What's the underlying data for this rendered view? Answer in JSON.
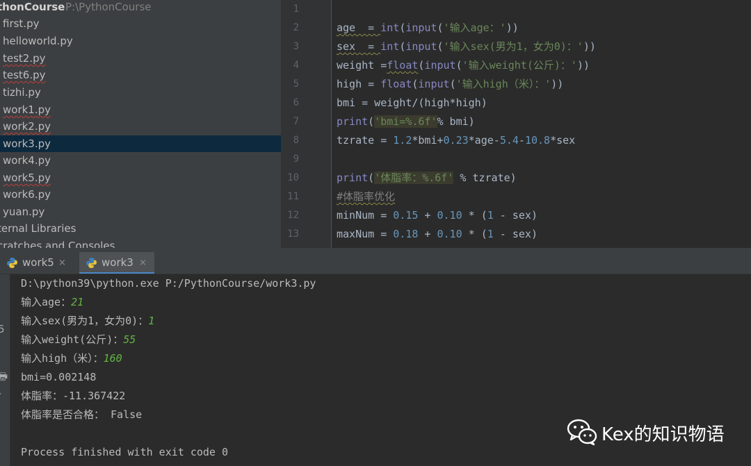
{
  "project": {
    "root_name": "thonCourse",
    "root_path": "P:\\PythonCourse",
    "files": [
      {
        "name": "first.py",
        "error": false
      },
      {
        "name": "helloworld.py",
        "error": false
      },
      {
        "name": "test2.py",
        "error": true
      },
      {
        "name": "test6.py",
        "error": true
      },
      {
        "name": "tizhi.py",
        "error": false
      },
      {
        "name": "work1.py",
        "error": true
      },
      {
        "name": "work2.py",
        "error": true
      },
      {
        "name": "work3.py",
        "error": false,
        "selected": true
      },
      {
        "name": "work4.py",
        "error": false
      },
      {
        "name": "work5.py",
        "error": true
      },
      {
        "name": "work6.py",
        "error": false
      },
      {
        "name": "yuan.py",
        "error": false
      }
    ],
    "external_libraries": "ternal Libraries",
    "scratches": "cratches and Consoles"
  },
  "editor": {
    "line_numbers": [
      "1",
      "2",
      "3",
      "4",
      "5",
      "6",
      "7",
      "8",
      "9",
      "10",
      "11",
      "12",
      "13"
    ],
    "code": {
      "l2": {
        "a": "age  = ",
        "b": "int",
        "c": "(",
        "d": "input",
        "e": "(",
        "f": "'输入age：'",
        "g": "))"
      },
      "l3": {
        "a": "sex  = ",
        "b": "int",
        "c": "(",
        "d": "input",
        "e": "(",
        "f": "'输入sex(男为1，女为0)：'",
        "g": "))"
      },
      "l4": {
        "a": "weight =",
        "b": "float",
        "c": "(",
        "d": "input",
        "e": "(",
        "f": "'输入weight(公斤)：'",
        "g": "))"
      },
      "l5": {
        "a": "high = ",
        "b": "float",
        "c": "(",
        "d": "input",
        "e": "(",
        "f": "'输入high（米）：'",
        "g": "))"
      },
      "l6": {
        "a": "bmi = weight/(high*high)"
      },
      "l7": {
        "a": "print",
        "b": "(",
        "c": "'bmi=%.6f'",
        "d": "% bmi)"
      },
      "l8": {
        "a": "tzrate = ",
        "b": "1.2",
        "c": "*bmi+",
        "d": "0.23",
        "e": "*age-",
        "f": "5.4",
        "g": "-",
        "h": "10.8",
        "i": "*sex"
      },
      "l10": {
        "a": "print",
        "b": "(",
        "c": "'体脂率：%.6f'",
        "d": " % tzrate)"
      },
      "l11": {
        "a": "#体脂率优化"
      },
      "l12": {
        "a": "minNum = ",
        "b": "0.15",
        "c": " + ",
        "d": "0.10",
        "e": " * (",
        "f": "1",
        "g": " - sex)"
      },
      "l13": {
        "a": "maxNum = ",
        "b": "0.18",
        "c": " + ",
        "d": "0.10",
        "e": " * (",
        "f": "1",
        "g": " - sex)"
      }
    }
  },
  "run": {
    "tabs": [
      {
        "label": "work5",
        "close": "×"
      },
      {
        "label": "work3",
        "close": "×"
      }
    ],
    "tool_glyphs": [
      "5",
      "🖶",
      "î"
    ],
    "console": {
      "command": "D:\\python39\\python.exe P:/PythonCourse/work3.py",
      "prompt_age": "输入age：",
      "val_age": "21",
      "prompt_sex": "输入sex(男为1，女为0)：",
      "val_sex": "1",
      "prompt_weight": "输入weight(公斤)：",
      "val_weight": "55",
      "prompt_high": "输入high（米）：",
      "val_high": "160",
      "bmi_out": "bmi=0.002148",
      "tz_out": "体脂率：-11.367422",
      "ok_out": "体脂率是否合格： False",
      "exit": "Process finished with exit code 0"
    }
  },
  "watermark": {
    "text": "Kex的知识物语",
    "icon": "wechat-icon"
  },
  "colors": {
    "selection": "#0d293e",
    "keyword_fn": "#8888c6",
    "string": "#6a8759",
    "number": "#6897bb",
    "input_value": "#62b543"
  }
}
